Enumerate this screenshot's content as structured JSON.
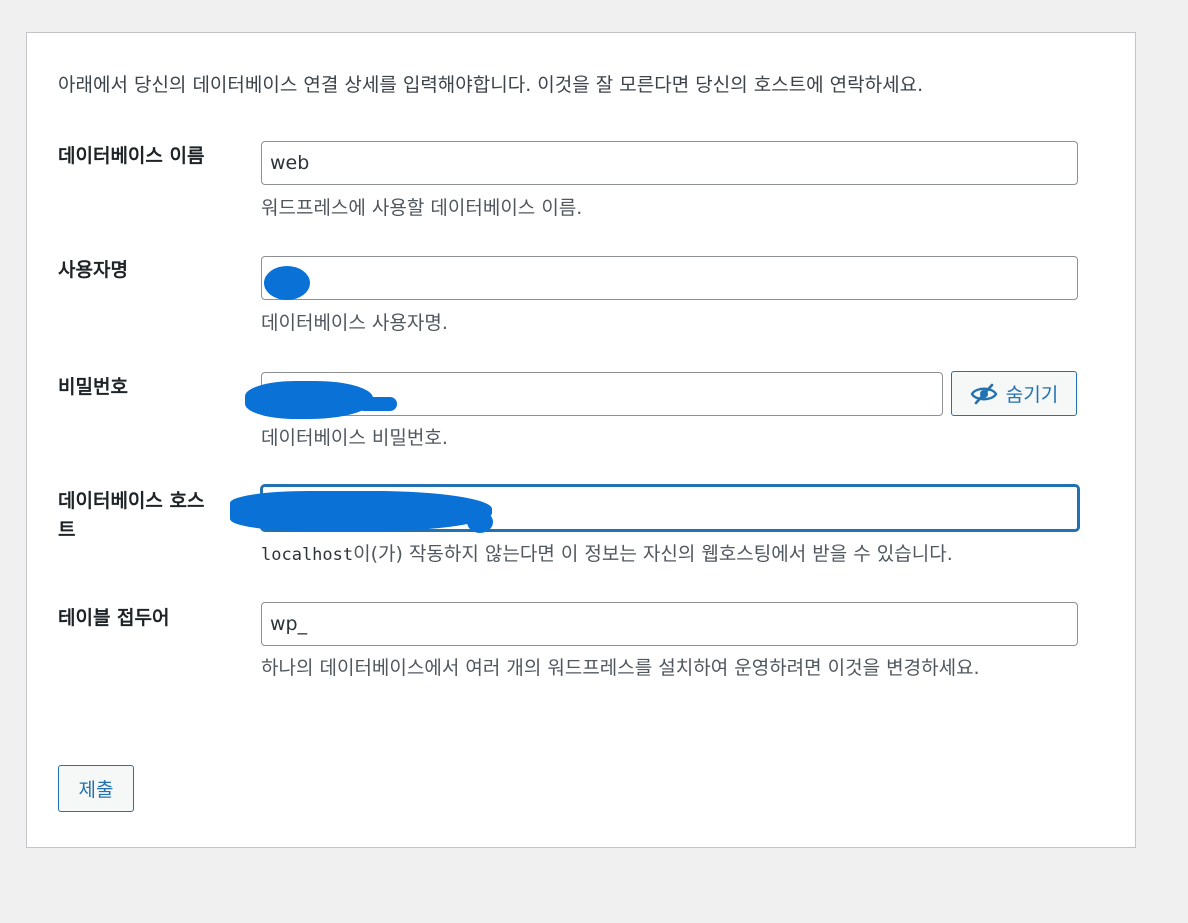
{
  "intro": "아래에서 당신의 데이터베이스 연결 상세를 입력해야합니다. 이것을 잘 모른다면 당신의 호스트에 연락하세요.",
  "fields": {
    "dbname": {
      "label": "데이터베이스 이름",
      "value": "web",
      "description": "워드프레스에 사용할 데이터베이스 이름."
    },
    "username": {
      "label": "사용자명",
      "value": "",
      "description": "데이터베이스 사용자명."
    },
    "password": {
      "label": "비밀번호",
      "value": "",
      "description": "데이터베이스 비밀번호.",
      "toggle_label": "숨기기"
    },
    "dbhost": {
      "label": "데이터베이스 호스트",
      "value": "",
      "description_code": "localhost",
      "description": "이(가) 작동하지 않는다면 이 정보는 자신의 웹호스팅에서 받을 수 있습니다."
    },
    "prefix": {
      "label": "테이블 접두어",
      "value": "wp_",
      "description": "하나의 데이터베이스에서 여러 개의 워드프레스를 설치하여 운영하려면 이것을 변경하세요."
    }
  },
  "submit_label": "제출",
  "colors": {
    "accent": "#2271b1",
    "redaction": "#0a72d6",
    "background": "#f0f0f1"
  },
  "icons": {
    "toggle": "eye-slash-icon"
  }
}
